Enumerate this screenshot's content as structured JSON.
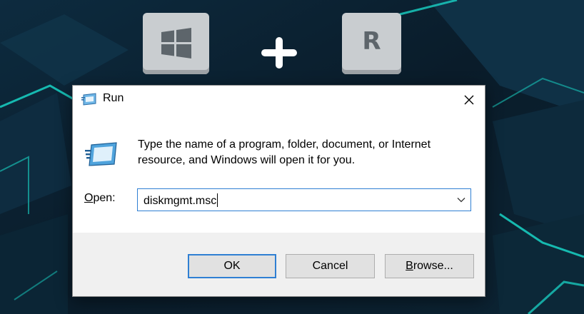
{
  "keys": {
    "win_key": "windows-logo-icon",
    "plus": "plus-icon",
    "r_key_label": "R"
  },
  "dialog": {
    "title": "Run",
    "description": "Type the name of a program, folder, document, or Internet resource, and Windows will open it for you.",
    "open_label_accel": "O",
    "open_label_rest": "pen:",
    "input_value": "diskmgmt.msc",
    "buttons": {
      "ok": "OK",
      "cancel": "Cancel",
      "browse_accel": "B",
      "browse_rest": "rowse..."
    }
  },
  "colors": {
    "accent": "#2f7fd3",
    "footer": "#f0f0f0",
    "key": "#c9cdd0",
    "background": "#0b2030",
    "neon": "#19d3c5"
  }
}
